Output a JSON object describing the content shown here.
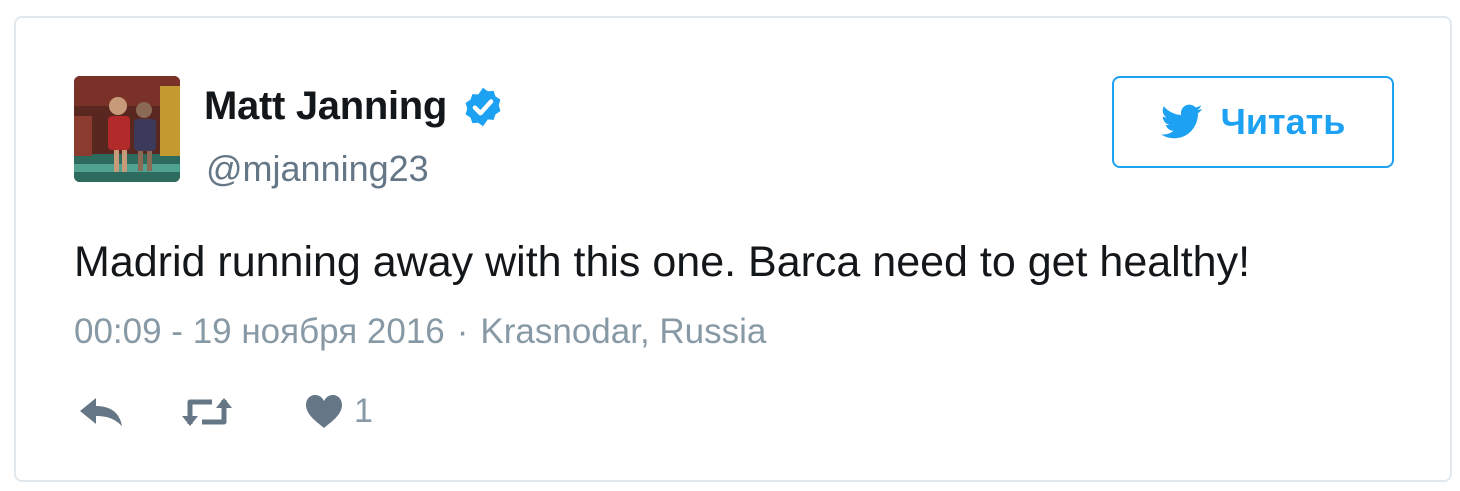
{
  "user": {
    "name": "Matt Janning",
    "handle": "@mjanning23",
    "verified": true
  },
  "follow_button": {
    "label": "Читать",
    "icon": "twitter-bird-icon"
  },
  "tweet": {
    "text": "Madrid running away with this one. Barca need to get healthy!",
    "timestamp": "00:09 - 19 ноября 2016",
    "separator": "·",
    "location": "Krasnodar, Russia"
  },
  "actions": {
    "reply_icon": "reply-icon",
    "retweet_icon": "retweet-icon",
    "like_icon": "heart-icon",
    "like_count": "1"
  },
  "colors": {
    "accent": "#1da1f2",
    "text": "#14171a",
    "muted": "#8899a6",
    "border": "#e1e8ed",
    "action_icon": "#657786"
  }
}
